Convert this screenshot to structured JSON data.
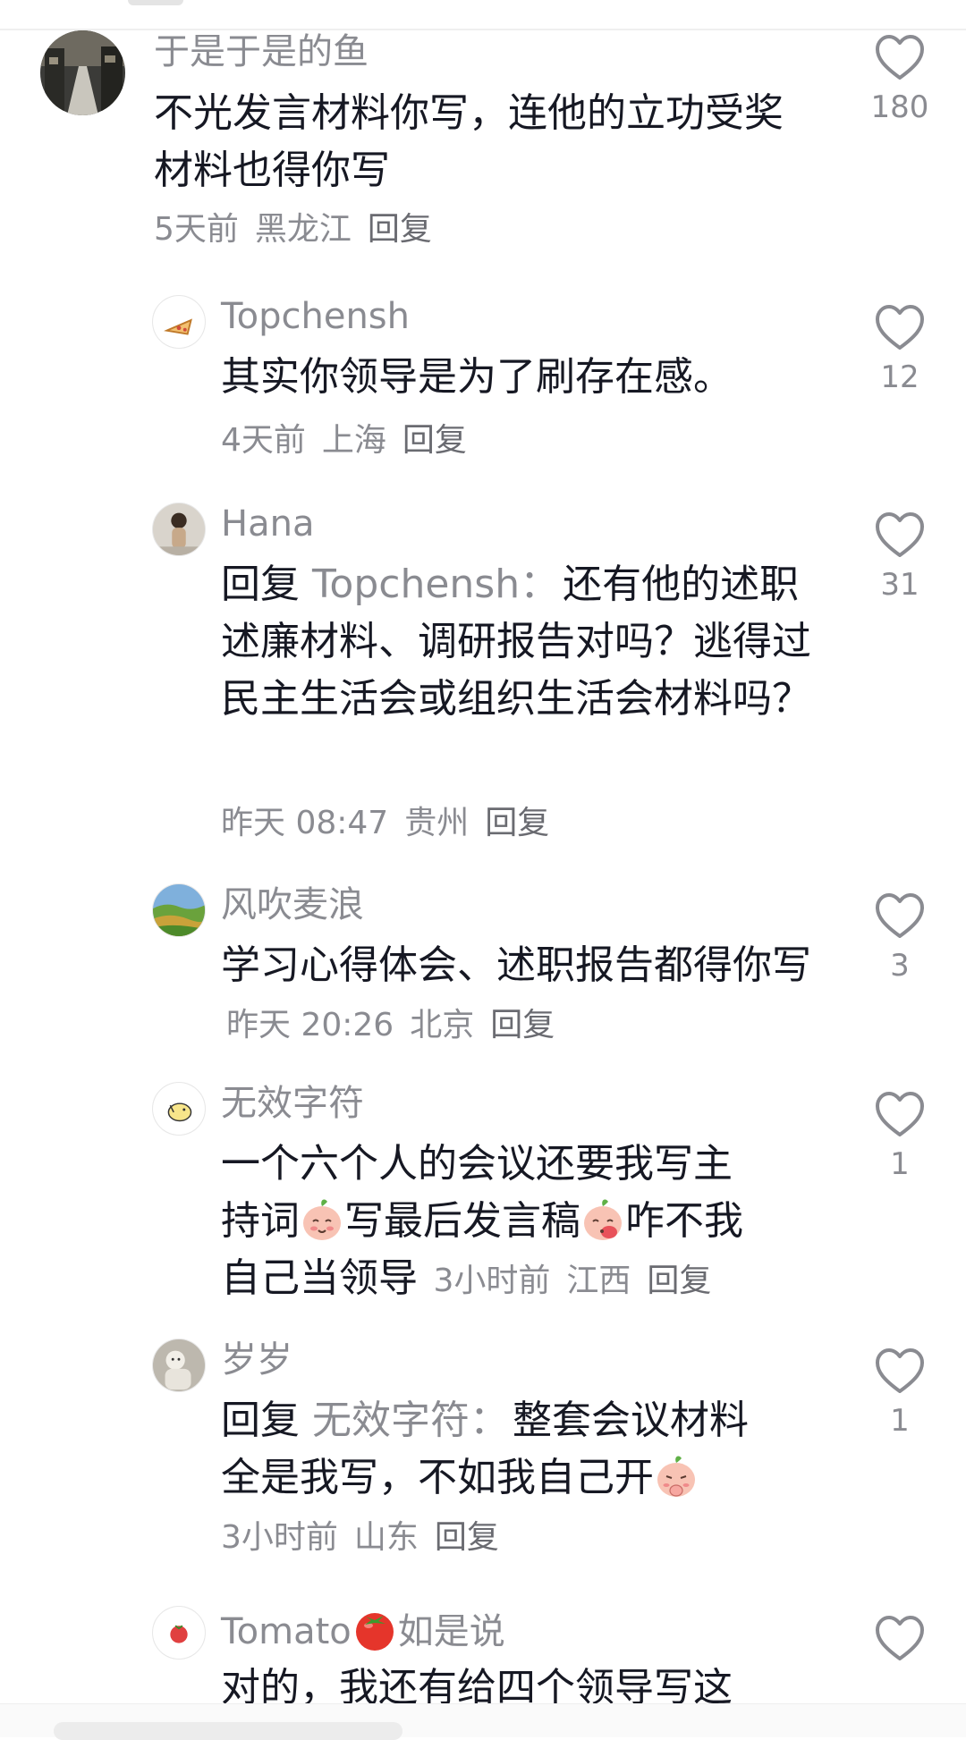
{
  "comments": [
    {
      "username": "于是于是的鱼",
      "text": "不光发言材料你写，连他的立功受奖材料也得你写",
      "time": "5天前",
      "location": "黑龙江",
      "reply_label": "回复",
      "likes": "180"
    },
    {
      "username": "Topchensh",
      "text": "其实你领导是为了刷存在感。",
      "time": "4天前",
      "location": "上海",
      "reply_label": "回复",
      "likes": "12"
    },
    {
      "username": "Hana",
      "reply_prefix": "回复",
      "reply_target": "Topchensh：",
      "text": "还有他的述职述廉材料、调研报告对吗？逃得过民主生活会或组织生活会材料吗？",
      "time": "昨天 08:47",
      "location": "贵州",
      "reply_label": "回复",
      "likes": "31"
    },
    {
      "username": "风吹麦浪",
      "text": "学习心得体会、述职报告都得你写",
      "time": "昨天 20:26",
      "location": "北京",
      "reply_label": "回复",
      "likes": "3"
    },
    {
      "username": "无效字符",
      "text_line1": "一个六个人的会议还要我写主",
      "text_part1": "持词",
      "text_part2": "写最后发言稿",
      "text_part3": "咋不我",
      "text_part4": "自己当领导",
      "time": "3小时前",
      "location": "江西",
      "reply_label": "回复",
      "likes": "1"
    },
    {
      "username": "岁岁",
      "reply_prefix": "回复",
      "reply_target": "无效字符：",
      "text_part1": "整套会议材料",
      "text_part2": "全是我写，不如我自己开",
      "time": "3小时前",
      "location": "山东",
      "reply_label": "回复",
      "likes": "1"
    },
    {
      "username_part1": "Tomato",
      "username_part2": "如是说",
      "text": "对的，我还有给四个领导写这"
    }
  ],
  "colors": {
    "text": "#161823",
    "secondary": "#8a8b91",
    "heart": "#8a8b91"
  }
}
